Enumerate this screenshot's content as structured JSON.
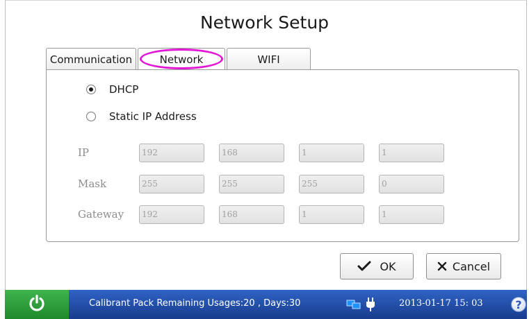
{
  "title": "Network Setup",
  "tabs": {
    "communication": "Communication",
    "network": "Network",
    "wifi": "WIFI",
    "active": "Network"
  },
  "mode": {
    "selected": "DHCP",
    "dhcp_label": "DHCP",
    "static_label": "Static IP Address"
  },
  "fields": {
    "ip": {
      "label": "IP",
      "octets": [
        "192",
        "168",
        "1",
        "1"
      ]
    },
    "mask": {
      "label": "Mask",
      "octets": [
        "255",
        "255",
        "255",
        "0"
      ]
    },
    "gateway": {
      "label": "Gateway",
      "octets": [
        "192",
        "168",
        "1",
        "1"
      ]
    }
  },
  "buttons": {
    "ok": "OK",
    "cancel": "Cancel"
  },
  "status": {
    "message": "Calibrant Pack Remaining Usages:20 , Days:30",
    "datetime": "2013-01-17  15: 03",
    "help": "?"
  },
  "colors": {
    "status_bar": "#2f63c4",
    "power_button": "#3fb44d",
    "highlight": "#e317d6"
  },
  "icons": [
    "power-icon",
    "network-status-icon",
    "plug-icon",
    "help-icon",
    "check-icon",
    "x-icon"
  ]
}
